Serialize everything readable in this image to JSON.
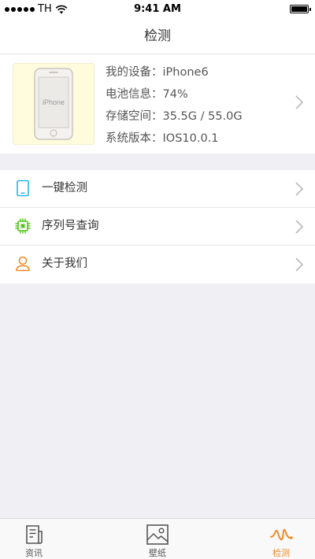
{
  "status_bar": {
    "carrier": "TH",
    "time": "9:41 AM"
  },
  "nav": {
    "title": "检测"
  },
  "device": {
    "thumbnail_text": "iPhone",
    "rows": [
      {
        "label": "我的设备：",
        "value": "iPhone6"
      },
      {
        "label": "电池信息：",
        "value": "74%"
      },
      {
        "label": "存储空间：",
        "value": "35.5G / 55.0G"
      },
      {
        "label": "系统版本：",
        "value": "IOS10.0.1"
      }
    ]
  },
  "menu": [
    {
      "label": "一键检测",
      "icon": "tablet-icon",
      "color": "#29b6e8"
    },
    {
      "label": "序列号查询",
      "icon": "chip-icon",
      "color": "#52c41a"
    },
    {
      "label": "关于我们",
      "icon": "person-icon",
      "color": "#f08a24"
    }
  ],
  "tabs": [
    {
      "label": "资讯",
      "icon": "news-icon",
      "active": false
    },
    {
      "label": "壁纸",
      "icon": "picture-icon",
      "active": false
    },
    {
      "label": "检测",
      "icon": "pulse-icon",
      "active": true
    }
  ],
  "colors": {
    "accent": "#f08a24",
    "background": "#efeff4"
  }
}
